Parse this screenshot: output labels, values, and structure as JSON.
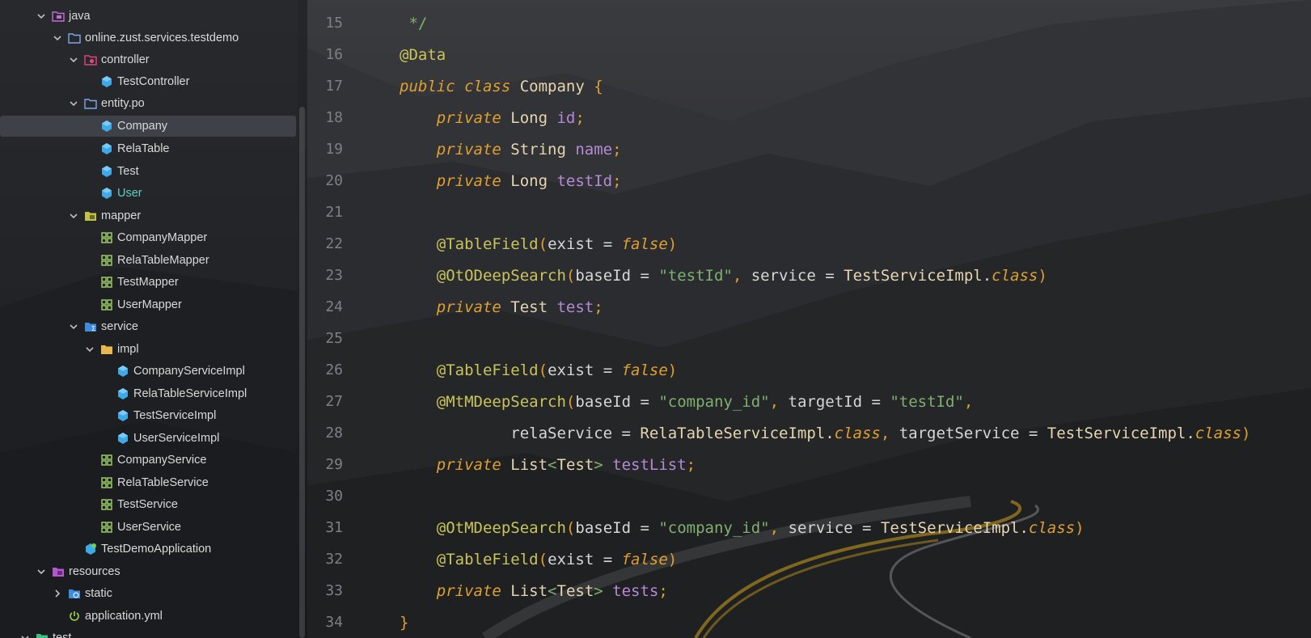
{
  "colors": {
    "keyword": "#e0a030",
    "annotation": "#c9c45a",
    "field": "#b68ad6",
    "string": "#7fb070",
    "tree_text": "#d9d9d9",
    "highlight_text": "#5fd1c4"
  },
  "tree": {
    "items": [
      {
        "label": "java",
        "icon": "java-source-folder-icon"
      },
      {
        "label": "online.zust.services.testdemo",
        "icon": "package-folder-icon"
      },
      {
        "label": "controller",
        "icon": "controller-folder-icon"
      },
      {
        "label": "TestController",
        "icon": "class-icon"
      },
      {
        "label": "entity.po",
        "icon": "package-folder-icon"
      },
      {
        "label": "Company",
        "icon": "class-icon"
      },
      {
        "label": "RelaTable",
        "icon": "class-icon"
      },
      {
        "label": "Test",
        "icon": "class-icon"
      },
      {
        "label": "User",
        "icon": "class-icon"
      },
      {
        "label": "mapper",
        "icon": "mapper-folder-icon"
      },
      {
        "label": "CompanyMapper",
        "icon": "interface-icon"
      },
      {
        "label": "RelaTableMapper",
        "icon": "interface-icon"
      },
      {
        "label": "TestMapper",
        "icon": "interface-icon"
      },
      {
        "label": "UserMapper",
        "icon": "interface-icon"
      },
      {
        "label": "service",
        "icon": "service-folder-icon"
      },
      {
        "label": "impl",
        "icon": "folder-icon"
      },
      {
        "label": "CompanyServiceImpl",
        "icon": "class-icon"
      },
      {
        "label": "RelaTableServiceImpl",
        "icon": "class-icon"
      },
      {
        "label": "TestServiceImpl",
        "icon": "class-icon"
      },
      {
        "label": "UserServiceImpl",
        "icon": "class-icon"
      },
      {
        "label": "CompanyService",
        "icon": "interface-icon"
      },
      {
        "label": "RelaTableService",
        "icon": "interface-icon"
      },
      {
        "label": "TestService",
        "icon": "interface-icon"
      },
      {
        "label": "UserService",
        "icon": "interface-icon"
      },
      {
        "label": "TestDemoApplication",
        "icon": "spring-app-icon"
      },
      {
        "label": "resources",
        "icon": "resources-folder-icon"
      },
      {
        "label": "static",
        "icon": "web-folder-icon"
      },
      {
        "label": "application.yml",
        "icon": "power-icon"
      },
      {
        "label": "test",
        "icon": "test-folder-icon"
      }
    ]
  },
  "editor": {
    "line_numbers": [
      "15",
      "16",
      "17",
      "18",
      "19",
      "20",
      "21",
      "22",
      "23",
      "24",
      "25",
      "26",
      "27",
      "28",
      "29",
      "30",
      "31",
      "32",
      "33",
      "34"
    ],
    "lines": [
      [
        {
          "t": "cmt",
          "v": " */"
        }
      ],
      [
        {
          "t": "ann",
          "v": "@Data"
        }
      ],
      [
        {
          "t": "kw",
          "v": "public class "
        },
        {
          "t": "cls",
          "v": "Company "
        },
        {
          "t": "br",
          "v": "{"
        }
      ],
      [
        {
          "t": "nm",
          "v": "    "
        },
        {
          "t": "kw",
          "v": "private "
        },
        {
          "t": "cls",
          "v": "Long "
        },
        {
          "t": "fld",
          "v": "id"
        },
        {
          "t": "pn",
          "v": ";"
        }
      ],
      [
        {
          "t": "nm",
          "v": "    "
        },
        {
          "t": "kw",
          "v": "private "
        },
        {
          "t": "cls",
          "v": "String "
        },
        {
          "t": "fld",
          "v": "name"
        },
        {
          "t": "pn",
          "v": ";"
        }
      ],
      [
        {
          "t": "nm",
          "v": "    "
        },
        {
          "t": "kw",
          "v": "private "
        },
        {
          "t": "cls",
          "v": "Long "
        },
        {
          "t": "fld",
          "v": "testId"
        },
        {
          "t": "pn",
          "v": ";"
        }
      ],
      [
        {
          "t": "nm",
          "v": ""
        }
      ],
      [
        {
          "t": "nm",
          "v": "    "
        },
        {
          "t": "ann",
          "v": "@TableField"
        },
        {
          "t": "br",
          "v": "("
        },
        {
          "t": "nm",
          "v": "exist = "
        },
        {
          "t": "kw",
          "v": "false"
        },
        {
          "t": "br",
          "v": ")"
        }
      ],
      [
        {
          "t": "nm",
          "v": "    "
        },
        {
          "t": "ann",
          "v": "@OtODeepSearch"
        },
        {
          "t": "br",
          "v": "("
        },
        {
          "t": "nm",
          "v": "baseId = "
        },
        {
          "t": "str",
          "v": "\"testId\""
        },
        {
          "t": "pn",
          "v": ", "
        },
        {
          "t": "nm",
          "v": "service = "
        },
        {
          "t": "cls",
          "v": "TestServiceImpl."
        },
        {
          "t": "kw",
          "v": "class"
        },
        {
          "t": "br",
          "v": ")"
        }
      ],
      [
        {
          "t": "nm",
          "v": "    "
        },
        {
          "t": "kw",
          "v": "private "
        },
        {
          "t": "cls",
          "v": "Test "
        },
        {
          "t": "fld",
          "v": "test"
        },
        {
          "t": "pn",
          "v": ";"
        }
      ],
      [
        {
          "t": "nm",
          "v": ""
        }
      ],
      [
        {
          "t": "nm",
          "v": "    "
        },
        {
          "t": "ann",
          "v": "@TableField"
        },
        {
          "t": "br",
          "v": "("
        },
        {
          "t": "nm",
          "v": "exist = "
        },
        {
          "t": "kw",
          "v": "false"
        },
        {
          "t": "br",
          "v": ")"
        }
      ],
      [
        {
          "t": "nm",
          "v": "    "
        },
        {
          "t": "ann",
          "v": "@MtMDeepSearch"
        },
        {
          "t": "br",
          "v": "("
        },
        {
          "t": "nm",
          "v": "baseId = "
        },
        {
          "t": "str",
          "v": "\"company_id\""
        },
        {
          "t": "pn",
          "v": ", "
        },
        {
          "t": "nm",
          "v": "targetId = "
        },
        {
          "t": "str",
          "v": "\"testId\""
        },
        {
          "t": "pn",
          "v": ","
        }
      ],
      [
        {
          "t": "nm",
          "v": "            relaService = "
        },
        {
          "t": "cls",
          "v": "RelaTableServiceImpl."
        },
        {
          "t": "kw",
          "v": "class"
        },
        {
          "t": "pn",
          "v": ", "
        },
        {
          "t": "nm",
          "v": "targetService = "
        },
        {
          "t": "cls",
          "v": "TestServiceImpl."
        },
        {
          "t": "kw",
          "v": "class"
        },
        {
          "t": "br",
          "v": ")"
        }
      ],
      [
        {
          "t": "nm",
          "v": "    "
        },
        {
          "t": "kw",
          "v": "private "
        },
        {
          "t": "cls",
          "v": "List"
        },
        {
          "t": "gen",
          "v": "<"
        },
        {
          "t": "cls",
          "v": "Test"
        },
        {
          "t": "gen",
          "v": "> "
        },
        {
          "t": "fld",
          "v": "testList"
        },
        {
          "t": "pn",
          "v": ";"
        }
      ],
      [
        {
          "t": "nm",
          "v": ""
        }
      ],
      [
        {
          "t": "nm",
          "v": "    "
        },
        {
          "t": "ann",
          "v": "@OtMDeepSearch"
        },
        {
          "t": "br",
          "v": "("
        },
        {
          "t": "nm",
          "v": "baseId = "
        },
        {
          "t": "str",
          "v": "\"company_id\""
        },
        {
          "t": "pn",
          "v": ", "
        },
        {
          "t": "nm",
          "v": "service = "
        },
        {
          "t": "cls",
          "v": "TestServiceImpl."
        },
        {
          "t": "kw",
          "v": "class"
        },
        {
          "t": "br",
          "v": ")"
        }
      ],
      [
        {
          "t": "nm",
          "v": "    "
        },
        {
          "t": "ann",
          "v": "@TableField"
        },
        {
          "t": "br",
          "v": "("
        },
        {
          "t": "nm",
          "v": "exist = "
        },
        {
          "t": "kw",
          "v": "false"
        },
        {
          "t": "br",
          "v": ")"
        }
      ],
      [
        {
          "t": "nm",
          "v": "    "
        },
        {
          "t": "kw",
          "v": "private "
        },
        {
          "t": "cls",
          "v": "List"
        },
        {
          "t": "gen",
          "v": "<"
        },
        {
          "t": "cls",
          "v": "Test"
        },
        {
          "t": "gen",
          "v": "> "
        },
        {
          "t": "fld",
          "v": "tests"
        },
        {
          "t": "pn",
          "v": ";"
        }
      ],
      [
        {
          "t": "br",
          "v": "}"
        }
      ]
    ]
  }
}
